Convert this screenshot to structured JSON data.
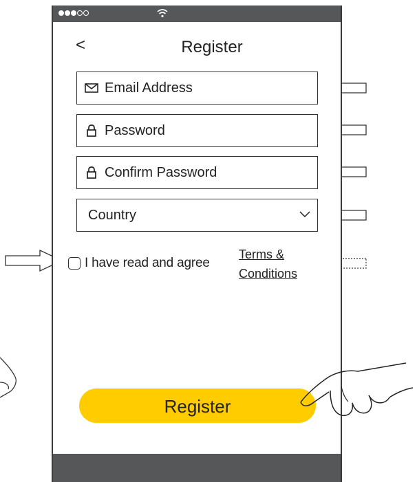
{
  "screen": {
    "title": "Register",
    "back_label": "<"
  },
  "form": {
    "email_placeholder": "Email Address",
    "password_placeholder": "Password",
    "confirm_password_placeholder": "Confirm Password",
    "country_label": "Country",
    "agree_label": "I have read and agree",
    "terms_line1": "Terms &",
    "terms_line2": "Conditions"
  },
  "actions": {
    "register_label": "Register"
  },
  "icons": {
    "email": "envelope-icon",
    "password": "lock-icon",
    "confirm": "lock-icon",
    "country": "chevron-down-icon",
    "wifi": "wifi-icon"
  },
  "colors": {
    "accent": "#ffcc00",
    "bars": "#555759"
  }
}
